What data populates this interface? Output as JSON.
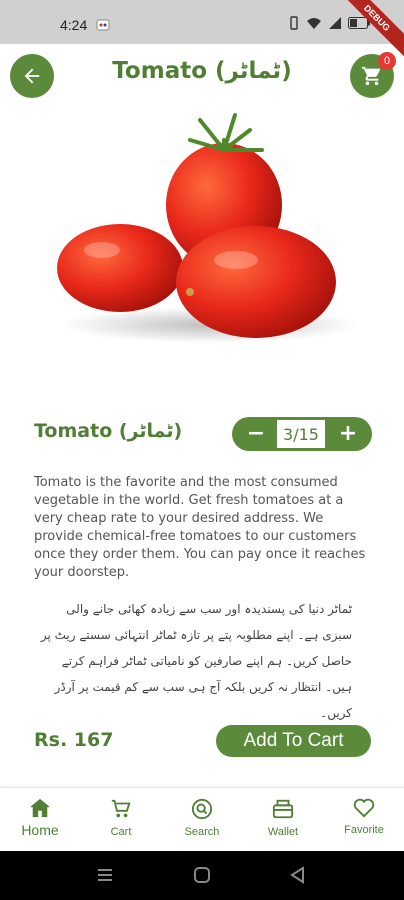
{
  "status_bar": {
    "time": "4:24",
    "debug_label": "DEBUG"
  },
  "header": {
    "title": "Tomato (ٹماٹر)",
    "cart_count": "0"
  },
  "product": {
    "name": "Tomato (ٹماٹر)",
    "quantity": "3/15",
    "minus_label": "−",
    "plus_label": "+",
    "description_en": "Tomato is the favorite and the most consumed vegetable in the world. Get fresh tomatoes at a very cheap rate to your desired address. We provide chemical-free tomatoes to our customers once they order them. You can pay once it reaches your doorstep.",
    "description_ur": "ٹماٹر دنیا کی پسندیدہ اور سب سے زیادہ کھائی جانے والی سبزی ہے۔ اپنے مطلوبہ پتے پر تازہ ٹماٹر انتہائی سستے ریٹ پر حاصل کریں۔ ہم اپنے صارفین کو نامیاتی ٹماٹر فراہم کرتے ہیں۔ انتظار نہ کریں بلکہ آج ہی سب سے کم قیمت پر آرڈر کریں۔",
    "price": "Rs. 167",
    "add_to_cart_label": "Add To Cart"
  },
  "bottom_nav": {
    "items": [
      {
        "label": "Home",
        "icon": "home-icon",
        "active": true
      },
      {
        "label": "Cart",
        "icon": "cart-icon"
      },
      {
        "label": "Search",
        "icon": "search-icon"
      },
      {
        "label": "Wallet",
        "icon": "wallet-icon"
      },
      {
        "label": "Favorite",
        "icon": "heart-icon"
      }
    ]
  },
  "colors": {
    "primary_green": "#5b8a3a",
    "title_green": "#4f7e34",
    "badge_red": "#e53935"
  }
}
